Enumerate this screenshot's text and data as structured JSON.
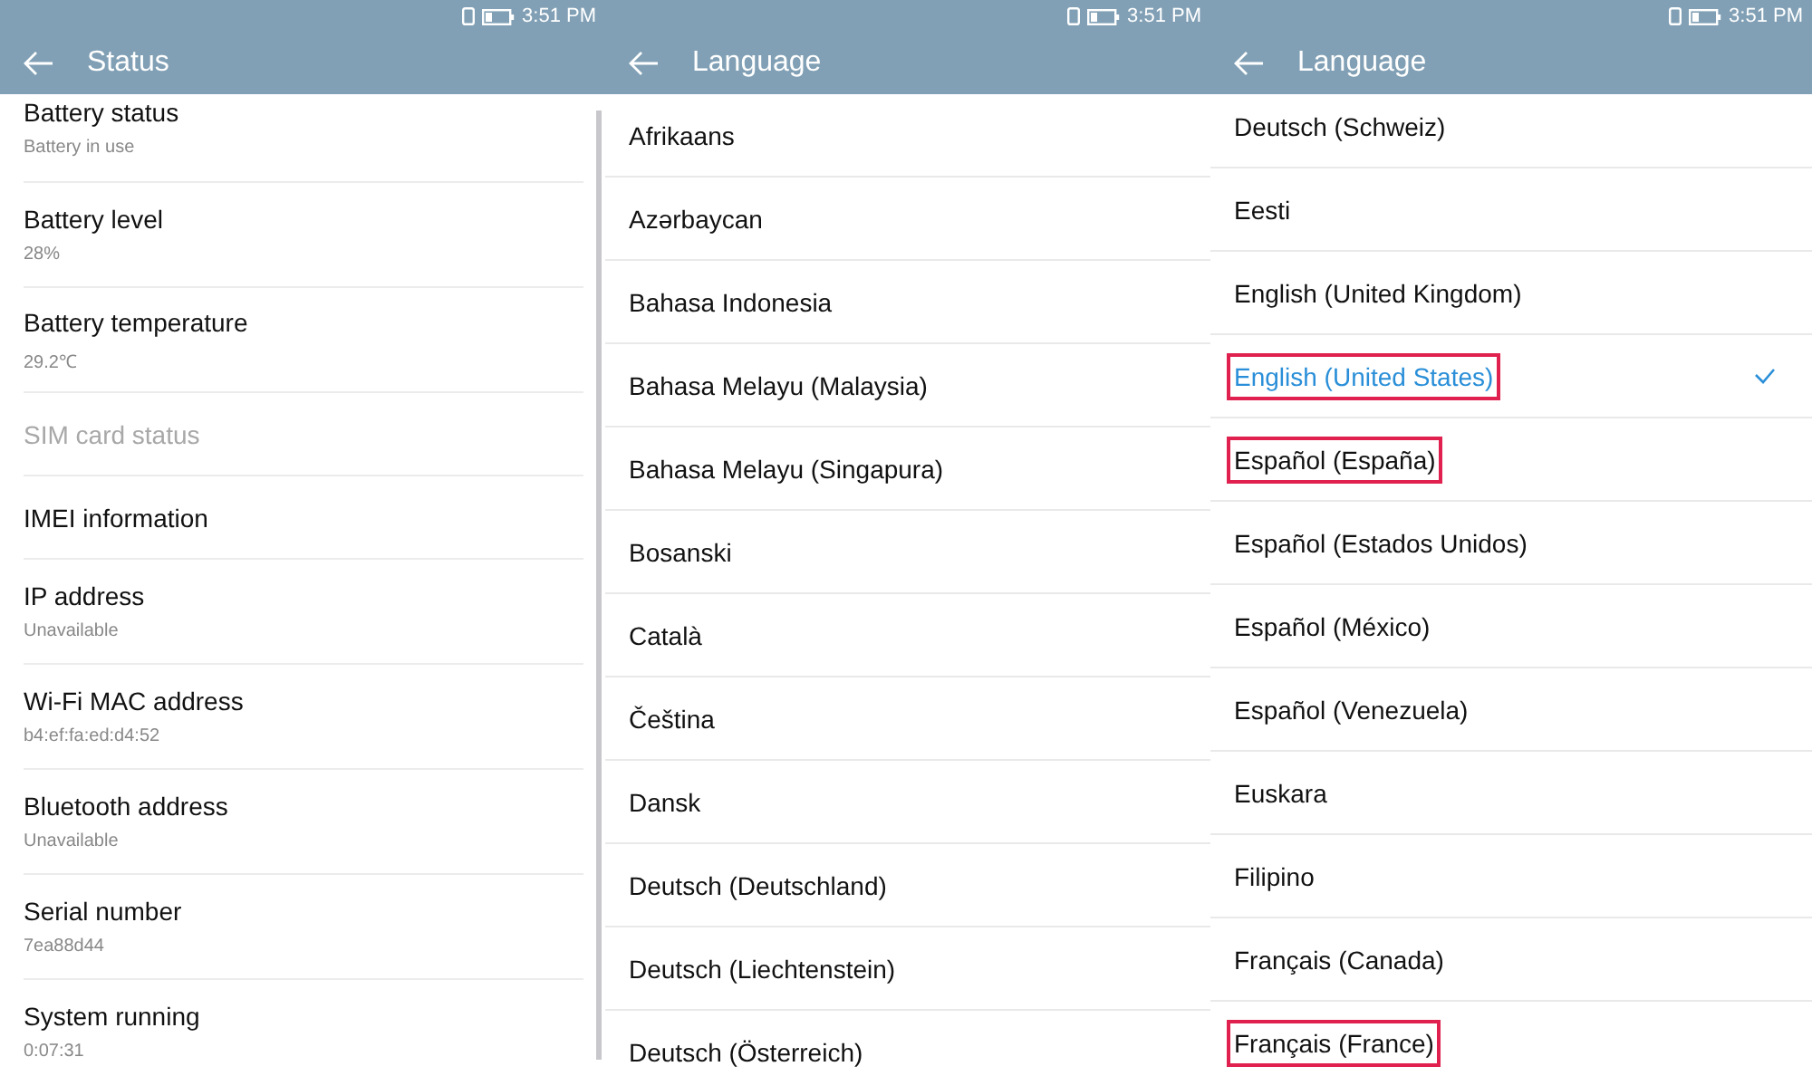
{
  "screens": [
    {
      "status_bar": {
        "time": "3:51 PM"
      },
      "title": "Status",
      "kind": "status",
      "items": [
        {
          "title": "Battery status",
          "value": "Battery in use",
          "disabled": false
        },
        {
          "title": "Battery level",
          "value": "28%",
          "disabled": false
        },
        {
          "title": "Battery temperature",
          "value": "29.2℃",
          "disabled": false
        },
        {
          "title": "SIM card status",
          "disabled": true
        },
        {
          "title": "IMEI information",
          "disabled": false
        },
        {
          "title": "IP address",
          "value": "Unavailable",
          "disabled": false
        },
        {
          "title": "Wi-Fi MAC address",
          "value": "b4:ef:fa:ed:d4:52",
          "disabled": false
        },
        {
          "title": "Bluetooth address",
          "value": "Unavailable",
          "disabled": false
        },
        {
          "title": "Serial number",
          "value": "7ea88d44",
          "disabled": false
        },
        {
          "title": "System running",
          "value": "0:07:31",
          "disabled": false
        }
      ]
    },
    {
      "status_bar": {
        "time": "3:51 PM"
      },
      "title": "Language",
      "kind": "language",
      "items": [
        {
          "title": "Afrikaans",
          "selected": false,
          "highlighted": false
        },
        {
          "title": "Azərbaycan",
          "selected": false,
          "highlighted": false
        },
        {
          "title": "Bahasa Indonesia",
          "selected": false,
          "highlighted": false
        },
        {
          "title": "Bahasa Melayu (Malaysia)",
          "selected": false,
          "highlighted": false
        },
        {
          "title": "Bahasa Melayu (Singapura)",
          "selected": false,
          "highlighted": false
        },
        {
          "title": "Bosanski",
          "selected": false,
          "highlighted": false
        },
        {
          "title": "Català",
          "selected": false,
          "highlighted": false
        },
        {
          "title": "Čeština",
          "selected": false,
          "highlighted": false
        },
        {
          "title": "Dansk",
          "selected": false,
          "highlighted": false
        },
        {
          "title": "Deutsch (Deutschland)",
          "selected": false,
          "highlighted": false
        },
        {
          "title": "Deutsch (Liechtenstein)",
          "selected": false,
          "highlighted": false
        },
        {
          "title": "Deutsch (Österreich)",
          "selected": false,
          "highlighted": false
        }
      ]
    },
    {
      "status_bar": {
        "time": "3:51 PM"
      },
      "title": "Language",
      "kind": "language",
      "items": [
        {
          "title": "Deutsch (Schweiz)",
          "selected": false,
          "highlighted": false
        },
        {
          "title": "Eesti",
          "selected": false,
          "highlighted": false
        },
        {
          "title": "English (United Kingdom)",
          "selected": false,
          "highlighted": false
        },
        {
          "title": "English (United States)",
          "selected": true,
          "highlighted": true
        },
        {
          "title": "Español (España)",
          "selected": false,
          "highlighted": true
        },
        {
          "title": "Español (Estados Unidos)",
          "selected": false,
          "highlighted": false
        },
        {
          "title": "Español (México)",
          "selected": false,
          "highlighted": false
        },
        {
          "title": "Español (Venezuela)",
          "selected": false,
          "highlighted": false
        },
        {
          "title": "Euskara",
          "selected": false,
          "highlighted": false
        },
        {
          "title": "Filipino",
          "selected": false,
          "highlighted": false
        },
        {
          "title": "Français (Canada)",
          "selected": false,
          "highlighted": false
        },
        {
          "title": "Français (France)",
          "selected": false,
          "highlighted": true
        }
      ]
    }
  ]
}
